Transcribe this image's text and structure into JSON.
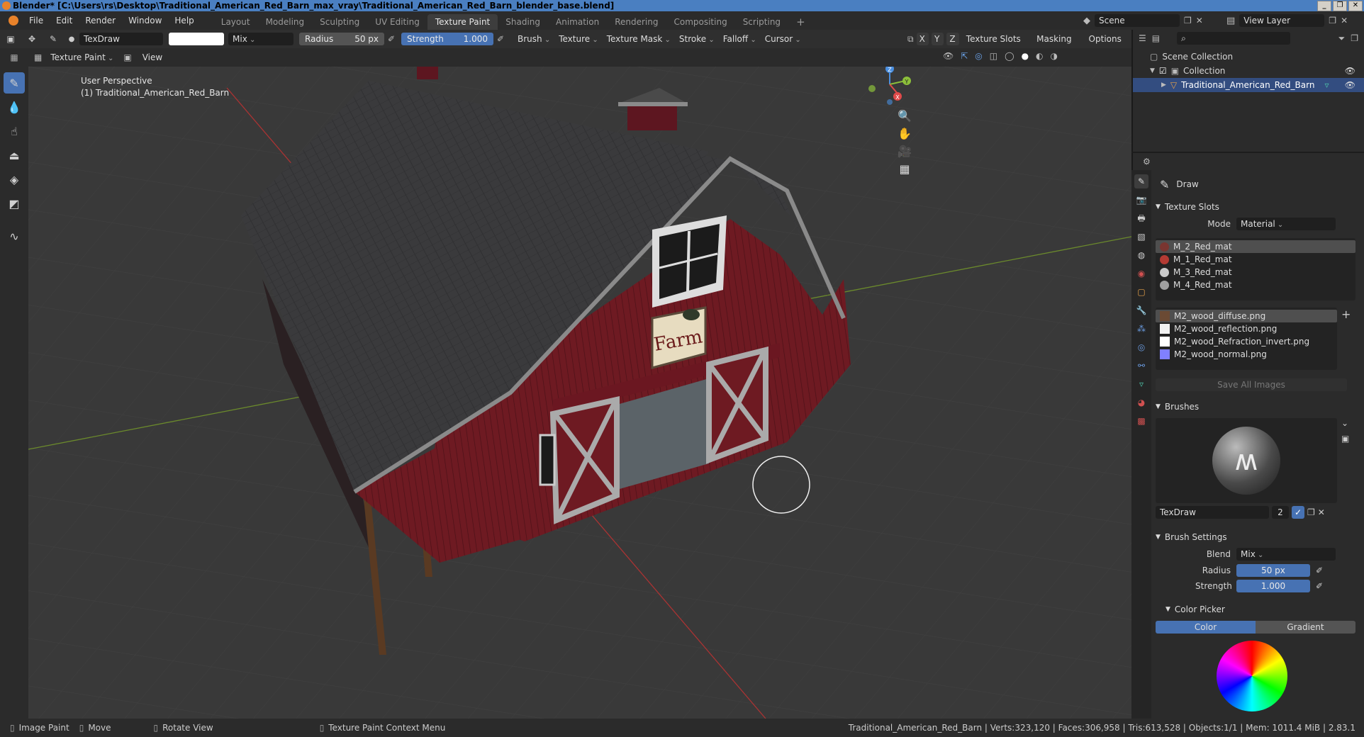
{
  "window": {
    "title": "Blender* [C:\\Users\\rs\\Desktop\\Traditional_American_Red_Barn_max_vray\\Traditional_American_Red_Barn_blender_base.blend]",
    "controls": [
      "_",
      "❐",
      "✕"
    ]
  },
  "menubar": {
    "menus": [
      "File",
      "Edit",
      "Render",
      "Window",
      "Help"
    ],
    "workspaces": [
      "Layout",
      "Modeling",
      "Sculpting",
      "UV Editing",
      "Texture Paint",
      "Shading",
      "Animation",
      "Rendering",
      "Compositing",
      "Scripting"
    ],
    "active_workspace": "Texture Paint",
    "add_tab": "+",
    "scene_label": "Scene",
    "view_layer_label": "View Layer"
  },
  "toolheader": {
    "brush_name": "TexDraw",
    "blend": "Mix",
    "radius_label": "Radius",
    "radius_value": "50 px",
    "strength_label": "Strength",
    "strength_value": "1.000",
    "menus": [
      "Brush",
      "Texture",
      "Texture Mask",
      "Stroke",
      "Falloff",
      "Cursor"
    ],
    "axes": [
      "X",
      "Y",
      "Z"
    ],
    "right_menus": [
      "Texture Slots",
      "Masking",
      "Options"
    ]
  },
  "viewport_header": {
    "mode": "Texture Paint",
    "view_menu": "View"
  },
  "viewport": {
    "perspective_label": "User Perspective",
    "object_label": "(1) Traditional_American_Red_Barn",
    "sign_text": "Farm",
    "gizmo_axes": [
      "X",
      "Y",
      "Z"
    ]
  },
  "outliner": {
    "root": "Scene Collection",
    "collection": "Collection",
    "object": "Traditional_American_Red_Barn"
  },
  "properties": {
    "tool_name": "Draw",
    "texture_slots_title": "Texture Slots",
    "mode_label": "Mode",
    "mode_value": "Material",
    "materials": [
      {
        "name": "M_2_Red_mat",
        "color": "#7a3530"
      },
      {
        "name": "M_1_Red_mat",
        "color": "#b33a33"
      },
      {
        "name": "M_3_Red_mat",
        "color": "#c9c9c9"
      },
      {
        "name": "M_4_Red_mat",
        "color": "#a0a0a0"
      }
    ],
    "images": [
      {
        "name": "M2_wood_diffuse.png",
        "color": "#6b4a34"
      },
      {
        "name": "M2_wood_reflection.png",
        "color": "#f2f2f2"
      },
      {
        "name": "M2_wood_Refraction_invert.png",
        "color": "#ffffff"
      },
      {
        "name": "M2_wood_normal.png",
        "color": "#8080ff"
      }
    ],
    "save_all": "Save All Images",
    "brushes_title": "Brushes",
    "brush_name": "TexDraw",
    "brush_users": "2",
    "brush_settings_title": "Brush Settings",
    "blend_label": "Blend",
    "blend_value": "Mix",
    "radius_label": "Radius",
    "radius_value": "50 px",
    "strength_label": "Strength",
    "strength_value": "1.000",
    "color_picker_title": "Color Picker",
    "color_tab": "Color",
    "gradient_tab": "Gradient"
  },
  "statusbar": {
    "items": [
      "Image Paint",
      "Move",
      "Rotate View",
      "Texture Paint Context Menu"
    ],
    "stats": "Traditional_American_Red_Barn | Verts:323,120 | Faces:306,958 | Tris:613,528 | Objects:1/1 | Mem: 1011.4 MiB | 2.83.1"
  },
  "colors": {
    "accent": "#4772b3",
    "barn_red": "#6e1a22",
    "roof": "#3a3a3c",
    "viewport_bg": "#393939"
  }
}
